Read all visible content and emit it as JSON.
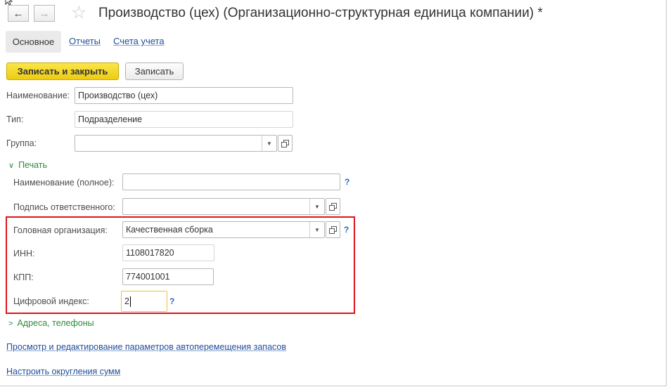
{
  "header": {
    "back_icon": "arrow-left-icon",
    "forward_icon": "arrow-right-icon",
    "favorite_icon": "star-icon",
    "title": "Производство (цех) (Организационно-структурная единица компании) *"
  },
  "tabs": [
    {
      "label": "Основное"
    },
    {
      "label": "Отчеты"
    },
    {
      "label": "Счета учета"
    }
  ],
  "toolbar": {
    "save_close_label": "Записать и закрыть",
    "save_label": "Записать"
  },
  "form": {
    "name_label": "Наименование:",
    "name_value": "Производство (цех)",
    "type_label": "Тип:",
    "type_value": "Подразделение",
    "group_label": "Группа:",
    "group_value": "",
    "print_group": {
      "title": "Печать",
      "full_name_label": "Наименование (полное):",
      "full_name_value": "",
      "signature_label": "Подпись ответственного:",
      "signature_value": "",
      "head_org_label": "Головная организация:",
      "head_org_value": "Качественная сборка",
      "inn_label": "ИНН:",
      "inn_value": "1108017820",
      "kpp_label": "КПП:",
      "kpp_value": "774001001",
      "digital_index_label": "Цифровой индекс:",
      "digital_index_value": "2",
      "help_mark": "?"
    },
    "address_group": {
      "title": "Адреса, телефоны"
    }
  },
  "links": {
    "auto_move": "Просмотр и редактирование параметров автоперемещения запасов",
    "rounding": "Настроить округления сумм"
  },
  "colors": {
    "accent_yellow": "#f0d21c",
    "highlight_red": "#e0141a",
    "group_green": "#2f8a3c",
    "link_blue": "#1f4e9a"
  }
}
